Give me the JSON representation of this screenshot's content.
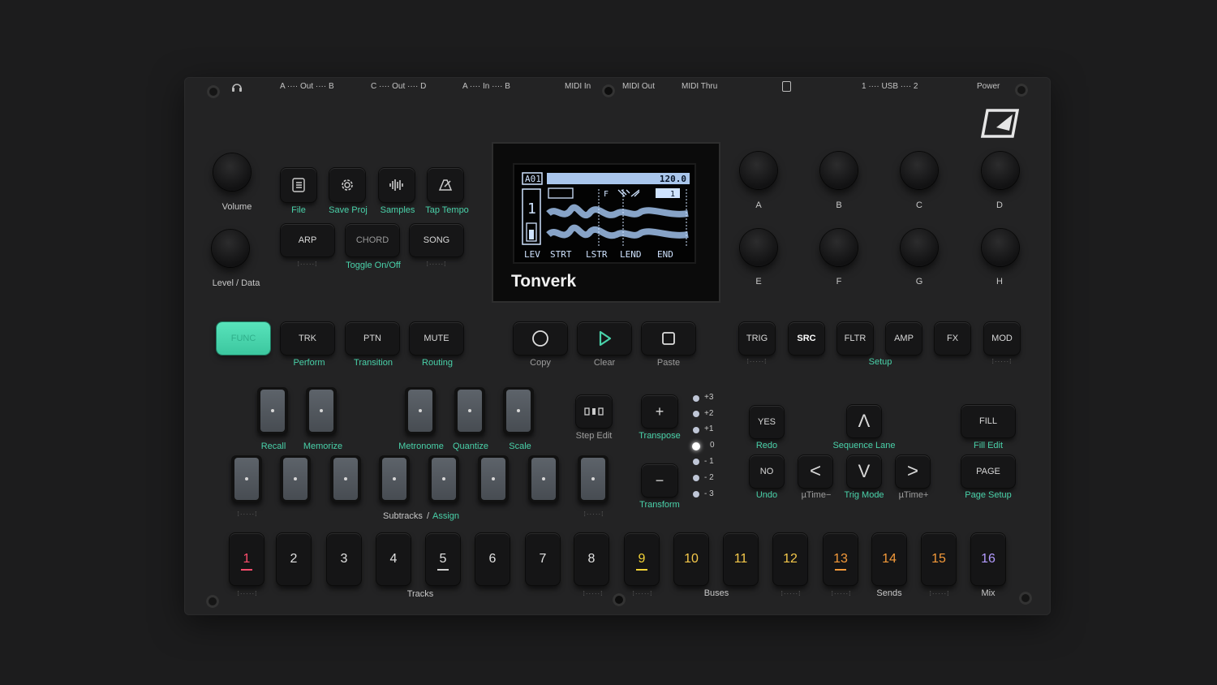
{
  "brand": "Tonverk",
  "io": {
    "out_ab": "A ···· Out ···· B",
    "out_cd": "C ···· Out ···· D",
    "in_ab": "A ····   In   ···· B",
    "midi_in": "MIDI In",
    "midi_out": "MIDI Out",
    "midi_thru": "MIDI Thru",
    "usb": "1  ····  USB  ····  2",
    "power": "Power"
  },
  "left": {
    "volume": "Volume",
    "level_data": "Level / Data",
    "file": "File",
    "save_proj": "Save Proj",
    "samples": "Samples",
    "tap_tempo": "Tap Tempo",
    "arp": "ARP",
    "chord": "CHORD",
    "song": "SONG",
    "toggle": "Toggle On/Off",
    "func": "FUNC",
    "trk": "TRK",
    "ptn": "PTN",
    "mute": "MUTE",
    "perform": "Perform",
    "transition": "Transition",
    "routing": "Routing",
    "copy": "Copy",
    "clear": "Clear",
    "paste": "Paste"
  },
  "screen": {
    "pattern": "A01",
    "tempo": "120.0",
    "flag": "F",
    "track_num": "1",
    "bank": "1",
    "params": [
      "LEV",
      "STRT",
      "LSTR",
      "LEND",
      "END"
    ]
  },
  "knobs": [
    "A",
    "B",
    "C",
    "D",
    "E",
    "F",
    "G",
    "H"
  ],
  "pages": {
    "trig": "TRIG",
    "src": "SRC",
    "fltr": "FLTR",
    "amp": "AMP",
    "fx": "FX",
    "mod": "MOD",
    "setup": "Setup"
  },
  "pads": {
    "recall": "Recall",
    "memorize": "Memorize",
    "metronome": "Metronome",
    "quantize": "Quantize",
    "scale": "Scale",
    "subtracks": "Subtracks",
    "assign": "Assign",
    "slash": "/"
  },
  "edit": {
    "step_edit": "Step Edit",
    "plus": "+",
    "minus": "−",
    "transpose": "Transpose",
    "transform": "Transform",
    "octaves": [
      "+3",
      "+2",
      "+1",
      "0",
      "- 1",
      "- 2",
      "- 3"
    ]
  },
  "nav": {
    "yes": "YES",
    "redo": "Redo",
    "no": "NO",
    "undo": "Undo",
    "up": "Λ",
    "down": "V",
    "left": "<",
    "right": ">",
    "sequence_lane": "Sequence Lane",
    "utime_minus": "µTime−",
    "trig_mode": "Trig Mode",
    "utime_plus": "µTime+",
    "fill": "FILL",
    "fill_edit": "Fill Edit",
    "page": "PAGE",
    "page_setup": "Page Setup"
  },
  "tracks": {
    "numbers": [
      "1",
      "2",
      "3",
      "4",
      "5",
      "6",
      "7",
      "8",
      "9",
      "10",
      "11",
      "12",
      "13",
      "14",
      "15",
      "16"
    ],
    "colors": {
      "t1": "#ff4d6d",
      "t9": "#f5d437",
      "b10": "#f5c84a",
      "b11": "#f5c84a",
      "b12": "#f5c84a",
      "s13": "#f59a3a",
      "s14": "#f59a3a",
      "s15": "#f59a3a",
      "mix": "#b39bff"
    },
    "tracks_label": "Tracks",
    "buses_label": "Buses",
    "sends_label": "Sends",
    "mix_label": "Mix"
  },
  "accent": "#49d1a9"
}
